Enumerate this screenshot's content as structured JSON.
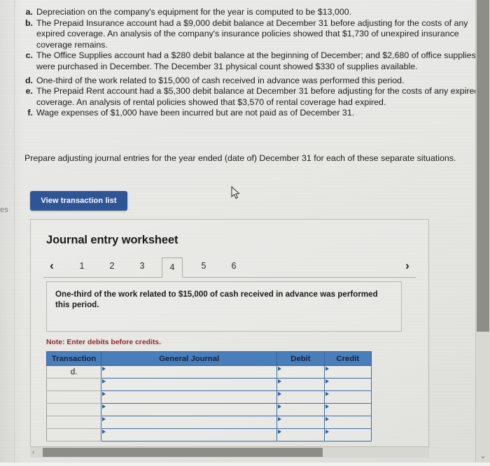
{
  "scenarios": [
    {
      "letter": "a.",
      "text": "Depreciation on the company's equipment for the year is computed to be $13,000."
    },
    {
      "letter": "b.",
      "text": "The Prepaid Insurance account had a $9,000 debit balance at December 31 before adjusting for the costs of any expired coverage. An analysis of the company's insurance policies showed that $1,730 of unexpired insurance coverage remains."
    },
    {
      "letter": "c.",
      "text": "The Office Supplies account had a $280 debit balance at the beginning of December; and $2,680 of office supplies were purchased in December. The December 31 physical count showed $330 of supplies available."
    },
    {
      "letter": "d.",
      "text": "One-third of the work related to $15,000 of cash received in advance was performed this period."
    },
    {
      "letter": "e.",
      "text": "The Prepaid Rent account had a $5,300 debit balance at December 31 before adjusting for the costs of any expired coverage. An analysis of rental policies showed that $3,570 of rental coverage had expired."
    },
    {
      "letter": "f.",
      "text": "Wage expenses of $1,000 have been incurred but are not paid as of December 31."
    }
  ],
  "prompt": "Prepare adjusting journal entries for the year ended (date of) December 31 for each of these separate situations.",
  "edge_fragment": "es",
  "buttons": {
    "view_transaction_list": "View transaction list"
  },
  "worksheet": {
    "title": "Journal entry worksheet",
    "pager": {
      "prev_icon": "‹",
      "next_icon": "›",
      "tabs": [
        "1",
        "2",
        "3",
        "4",
        "5",
        "6"
      ],
      "active_tab": "4"
    },
    "callout_text": "One-third of the work related to $15,000 of cash received in advance was performed this period.",
    "note": "Note: Enter debits before credits.",
    "table": {
      "headers": [
        "Transaction",
        "General Journal",
        "Debit",
        "Credit"
      ],
      "rows": [
        {
          "transaction": "d.",
          "general_journal": "",
          "debit": "",
          "credit": ""
        },
        {
          "transaction": "",
          "general_journal": "",
          "debit": "",
          "credit": ""
        },
        {
          "transaction": "",
          "general_journal": "",
          "debit": "",
          "credit": ""
        },
        {
          "transaction": "",
          "general_journal": "",
          "debit": "",
          "credit": ""
        },
        {
          "transaction": "",
          "general_journal": "",
          "debit": "",
          "credit": ""
        },
        {
          "transaction": "",
          "general_journal": "",
          "debit": "",
          "credit": ""
        }
      ]
    }
  },
  "scrollbars": {
    "horizontal_left_arrow": "‹",
    "vertical_down_arrow": "⌄"
  },
  "colors": {
    "button_blue": "#2f5597",
    "table_header_blue": "#4a7ebb",
    "note_red": "#8c2b2b",
    "page_bg": "#e9e9e6"
  }
}
